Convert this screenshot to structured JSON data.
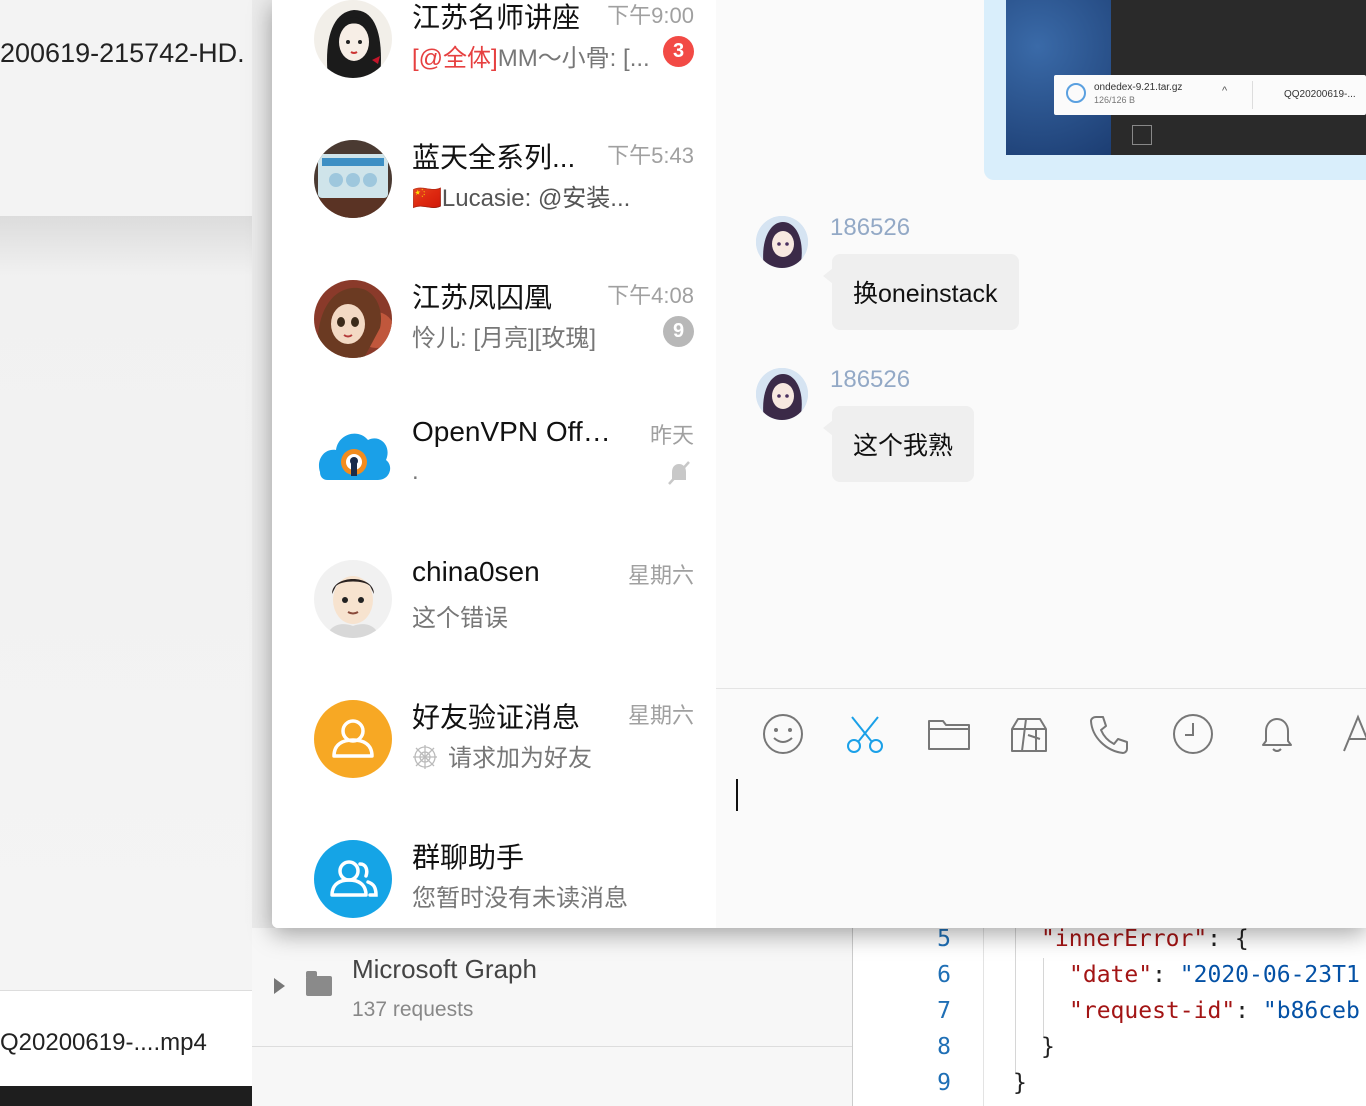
{
  "background": {
    "left_top_filename": "200619-215742-HD.",
    "left_bottom_filename": "Q20200619-....mp4",
    "collection": {
      "name": "Microsoft Graph",
      "count": "137 requests"
    },
    "code": {
      "line_numbers": [
        "5",
        "6",
        "7",
        "8",
        "9"
      ],
      "inner_error_key": "\"innerError\"",
      "inner_error_open": ": {",
      "date_key": "\"date\"",
      "date_colon": ": ",
      "date_value": "\"2020-06-23T1",
      "request_id_key": "\"request-id\"",
      "request_id_colon": ": ",
      "request_id_value": "\"b86ceb",
      "close_inner": "}",
      "close_outer": "}"
    }
  },
  "conversations": [
    {
      "name": "江苏名师讲座",
      "time": "下午9:00",
      "mention": "[@全体]",
      "preview": "MM～小骨: [...",
      "badge": "3",
      "badge_style": "red"
    },
    {
      "name": "蓝天全系列...",
      "time": "下午5:43",
      "preview": "🇨🇳Lucasie: @安装...",
      "badge": ""
    },
    {
      "name": "江苏凤囚凰",
      "time": "下午4:08",
      "preview": "怜儿: [月亮][玫瑰]",
      "badge": "9",
      "badge_style": "grey"
    },
    {
      "name": "OpenVPN Offic...",
      "time": "昨天",
      "preview": ".",
      "badge": "",
      "muted": true
    },
    {
      "name": "china0sen",
      "time": "星期六",
      "preview": "这个错误",
      "badge": ""
    },
    {
      "name": "好友验证消息",
      "time": "星期六",
      "preview": "请求加为好友",
      "badge": ""
    },
    {
      "name": "群聊助手",
      "time": "",
      "preview": "您暂时没有未读消息",
      "badge": ""
    }
  ],
  "chat": {
    "image_attachment": {
      "download_name": "ondedex-9.21.tar.gz",
      "download_size": "126/126 B",
      "download_name_2": "QQ20200619-..."
    },
    "messages": [
      {
        "sender": "186526",
        "text": "换oneinstack"
      },
      {
        "sender": "186526",
        "text": "这个我熟"
      }
    ]
  },
  "toolbar": {
    "icons": [
      "emoji-icon",
      "scissors-icon",
      "folder-icon",
      "gift-icon",
      "phone-icon",
      "clock-icon",
      "bell-icon",
      "font-icon"
    ]
  },
  "colors": {
    "accent_blue": "#1aa0e8",
    "badge_red": "#f24a45",
    "sender_name": "#93a9c6",
    "bubble_grey": "#efefef"
  }
}
